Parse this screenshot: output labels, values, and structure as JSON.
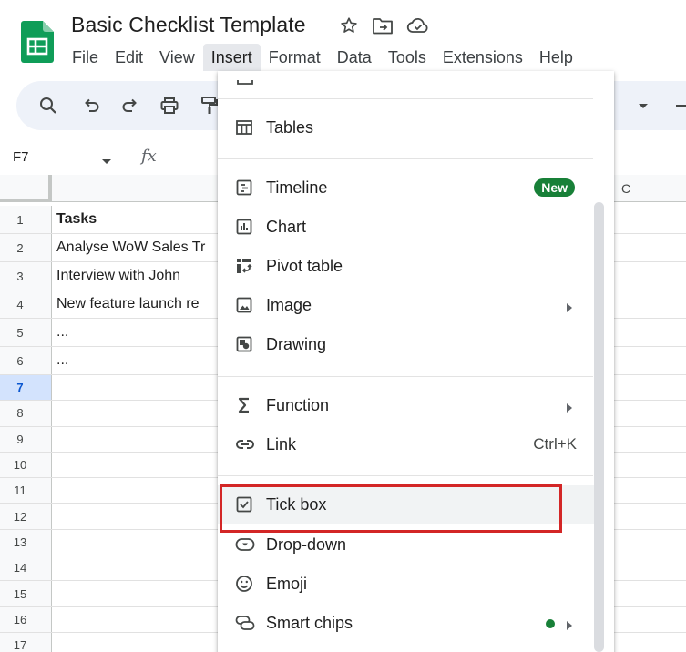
{
  "document": {
    "title": "Basic Checklist Template"
  },
  "menubar": [
    {
      "label": "File"
    },
    {
      "label": "Edit"
    },
    {
      "label": "View"
    },
    {
      "label": "Insert"
    },
    {
      "label": "Format"
    },
    {
      "label": "Data"
    },
    {
      "label": "Tools"
    },
    {
      "label": "Extensions"
    },
    {
      "label": "Help"
    }
  ],
  "formula_bar": {
    "cell_ref": "F7",
    "fx_label": "fx"
  },
  "sheet": {
    "column_c": "C",
    "rows": [
      {
        "num": "1",
        "text": "Tasks"
      },
      {
        "num": "2",
        "text": "Analyse WoW Sales Tr"
      },
      {
        "num": "3",
        "text": "Interview with John"
      },
      {
        "num": "4",
        "text": "New feature launch re"
      },
      {
        "num": "5",
        "text": "..."
      },
      {
        "num": "6",
        "text": "..."
      },
      {
        "num": "7",
        "text": ""
      },
      {
        "num": "8",
        "text": ""
      },
      {
        "num": "9",
        "text": ""
      },
      {
        "num": "10",
        "text": ""
      },
      {
        "num": "11",
        "text": ""
      },
      {
        "num": "12",
        "text": ""
      },
      {
        "num": "13",
        "text": ""
      },
      {
        "num": "14",
        "text": ""
      },
      {
        "num": "15",
        "text": ""
      },
      {
        "num": "16",
        "text": ""
      },
      {
        "num": "17",
        "text": ""
      }
    ]
  },
  "insert_menu": {
    "tables": "Tables",
    "timeline": "Timeline",
    "timeline_badge": "New",
    "chart": "Chart",
    "pivot_table": "Pivot table",
    "image": "Image",
    "drawing": "Drawing",
    "function": "Function",
    "link": "Link",
    "link_shortcut": "Ctrl+K",
    "tick_box": "Tick box",
    "drop_down": "Drop-down",
    "emoji": "Emoji",
    "smart_chips": "Smart chips"
  },
  "colors": {
    "sheets_green": "#0f9d58",
    "badge_green": "#188038",
    "highlight_red": "#d32626",
    "selected_row": "#d3e3fd"
  }
}
